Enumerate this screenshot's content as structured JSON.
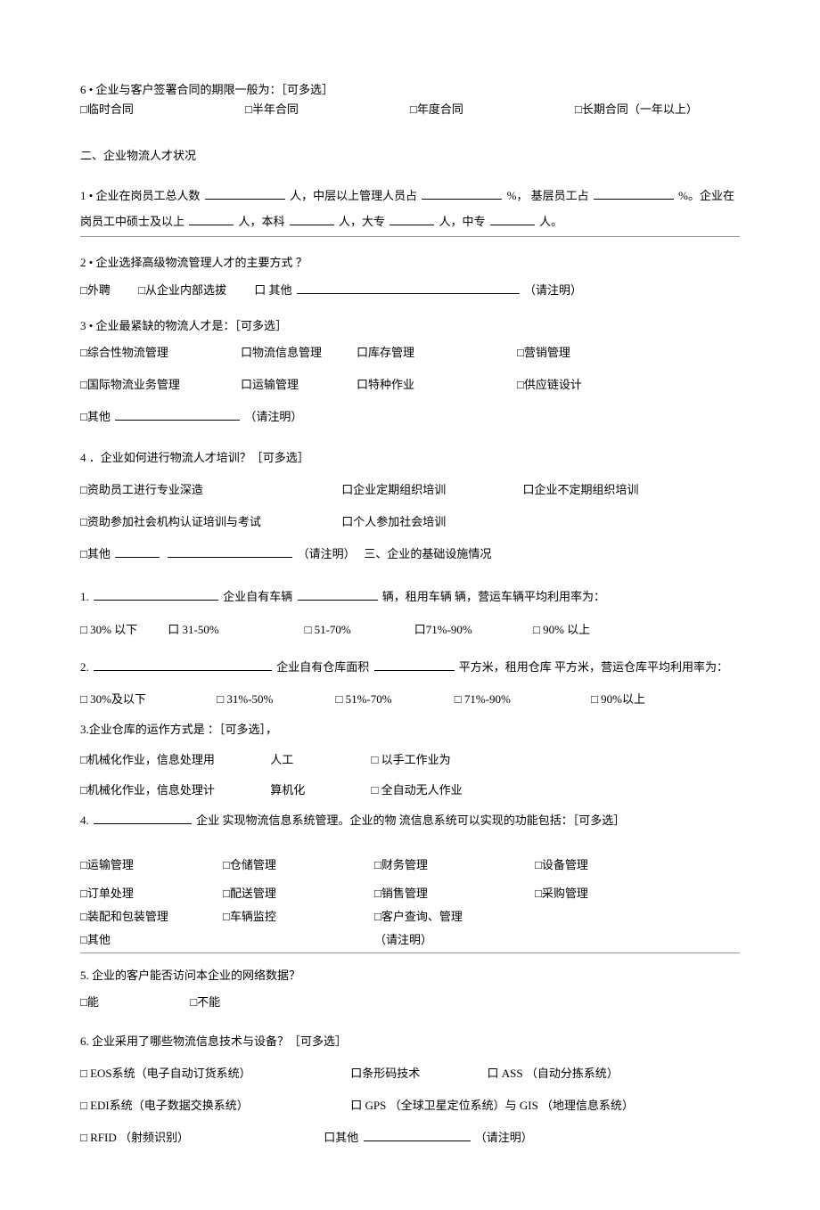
{
  "q6": {
    "title": "6 • 企业与客户签署合同的期限一般为：［可多选］",
    "opts": [
      "□临时合同",
      "□半年合同",
      "□年度合同",
      "□长期合同（一年以上）"
    ]
  },
  "section2": {
    "title": "二、企业物流人才状况",
    "q1_prefix": "1 • 企业在岗员工总人数",
    "q1_mid1": "人，中层以上管理人员占",
    "q1_mid2": "%，   基层员工占",
    "q1_mid3": "%。企业在岗员工中硕士及以上",
    "q1_bs": "人，本科",
    "q1_dz": "人，大专",
    "q1_zz": "人，中专",
    "q1_end": "人。",
    "q2": "2 • 企业选择高级物流管理人才的主要方式           ？",
    "q2_opts": [
      "□外聘",
      "□从企业内部选拔",
      "口 其他"
    ],
    "q2_note": "（请注明）",
    "q3": "3 • 企业最紧缺的物流人才是：［可多选］",
    "q3_row1": [
      "□综合性物流管理",
      "口物流信息管理",
      "口库存管理",
      "□营销管理"
    ],
    "q3_row2": [
      "□国际物流业务管理",
      "口运输管理",
      "口特种作业",
      "□供应链设计"
    ],
    "q3_other": "□其他",
    "q3_note": "（请注明）",
    "q4": "4 ．企业如何进行物流人才培训？［可多选］",
    "q4_row1": [
      "□资助员工进行专业深造",
      "口企业定期组织培训",
      "口企业不定期组织培训"
    ],
    "q4_row2": [
      "□资助参加社会机构认证培训与考试",
      "口个人参加社会培训"
    ],
    "q4_other": "□其他",
    "q4_note": "（请注明）",
    "section3_inline": "三、企业的基础设施情况"
  },
  "section3": {
    "q1_pre": "1.",
    "q1_mid1": "企业自有车辆",
    "q1_mid2": "辆，租用车辆   辆，营运车辆平均利用率为：",
    "q1_opts": [
      "□ 30% 以下",
      "口 31-50%",
      "□ 51-70%",
      "口71%-90%",
      "□ 90% 以上"
    ],
    "q2_pre": "2.",
    "q2_mid1": "企业自有仓库面积",
    "q2_mid2": "平方米，租用仓库   平方米，营运仓库平均利用率为：",
    "q2_opts": [
      "□ 30%及以下",
      "□ 31%-50%",
      "□ 51%-70%",
      "□ 71%-90%",
      "□ 90%以上"
    ],
    "q3": "3.企业仓库的运作方式是       ：［可多选］，",
    "q3_row1a": "□机械化作业，信息处理用",
    "q3_row1b": "人工",
    "q3_row1c": "□ 以手工作业为",
    "q3_row2a": "□机械化作业，信息处理计",
    "q3_row2b": "算机化",
    "q3_row2c": "□ 全自动无人作业",
    "q4_pre": "4.",
    "q4_mid": "企业    实现物流信息系统管理。企业的物  流信息系统可以实现的功能包括：［可多选］",
    "q4_row1": [
      "□运输管理",
      "□仓储管理",
      "□财务管理",
      "□设备管理"
    ],
    "q4_row2": [
      "□订单处理",
      "□配送管理",
      "□销售管理",
      "□采购管理"
    ],
    "q4_row3": [
      "□装配和包装管理",
      "□车辆监控",
      "□客户查询、管理",
      ""
    ],
    "q4_other": "□其他",
    "q4_note": "（请注明）",
    "q5": "5.    企业的客户能否访问本企业的网络数据？",
    "q5_opts": [
      "□能",
      "□不能"
    ],
    "q6": "6.    企业采用了哪些物流信息技术与设备？［可多选］",
    "q6_row1": [
      "□    EOS系统（电子自动订货系统）",
      "口条形码技术",
      "口 ASS （自动分拣系统）"
    ],
    "q6_row2": [
      "□    EDI系统（电子数据交换系统）",
      "口 GPS （全球卫星定位系统）与 GIS （地理信息系统）"
    ],
    "q6_row3a": "□    RFID （射频识别）",
    "q6_row3b": "口其他",
    "q6_note": "（请注明）"
  }
}
